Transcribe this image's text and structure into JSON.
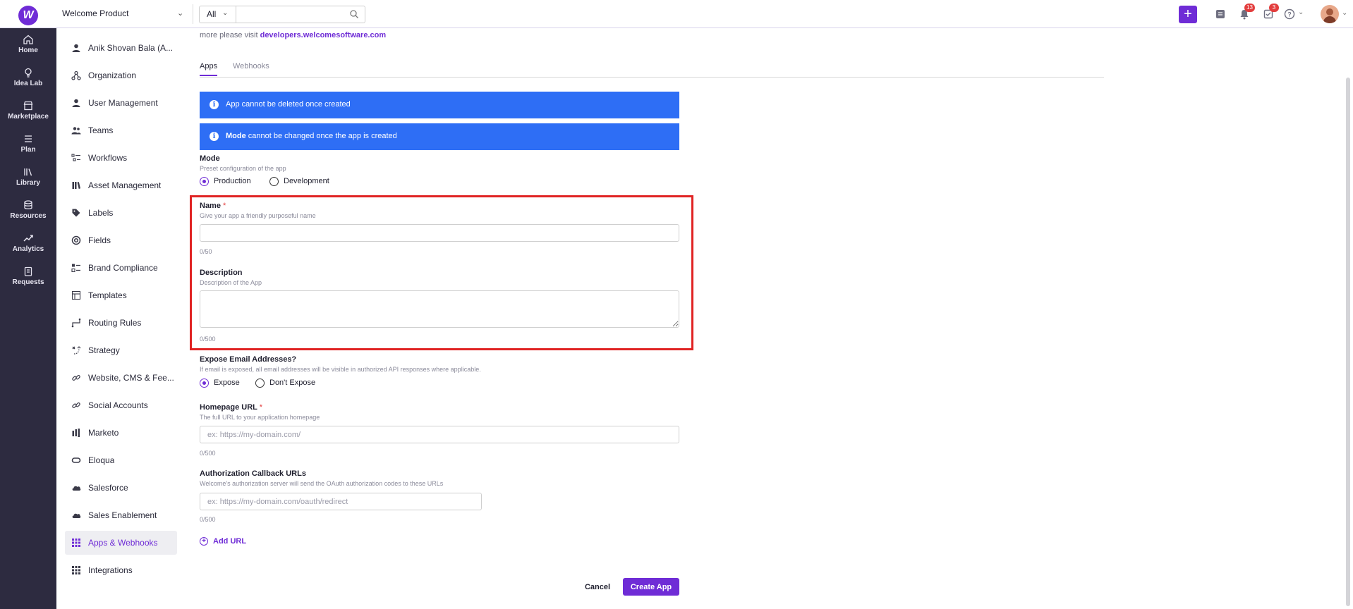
{
  "header": {
    "workspace": "Welcome Product",
    "search_scope": "All",
    "search_placeholder": "",
    "notifications_count": "13",
    "tasks_count": "3"
  },
  "rail": [
    {
      "label": "Home",
      "icon": "home-icon"
    },
    {
      "label": "Idea Lab",
      "icon": "lightbulb-icon"
    },
    {
      "label": "Marketplace",
      "icon": "store-icon"
    },
    {
      "label": "Plan",
      "icon": "list-icon"
    },
    {
      "label": "Library",
      "icon": "library-icon"
    },
    {
      "label": "Resources",
      "icon": "database-icon"
    },
    {
      "label": "Analytics",
      "icon": "trend-icon"
    },
    {
      "label": "Requests",
      "icon": "clipboard-icon"
    }
  ],
  "sidebar": {
    "items": [
      {
        "label": "Anik Shovan Bala (A...",
        "icon": "person-icon"
      },
      {
        "label": "Organization",
        "icon": "org-icon"
      },
      {
        "label": "User Management",
        "icon": "person-icon"
      },
      {
        "label": "Teams",
        "icon": "team-icon"
      },
      {
        "label": "Workflows",
        "icon": "workflow-icon"
      },
      {
        "label": "Asset Management",
        "icon": "books-icon"
      },
      {
        "label": "Labels",
        "icon": "tag-icon"
      },
      {
        "label": "Fields",
        "icon": "target-icon"
      },
      {
        "label": "Brand Compliance",
        "icon": "checklist-icon"
      },
      {
        "label": "Templates",
        "icon": "template-icon"
      },
      {
        "label": "Routing Rules",
        "icon": "routing-icon"
      },
      {
        "label": "Strategy",
        "icon": "strategy-icon"
      },
      {
        "label": "Website, CMS & Fee...",
        "icon": "link-icon"
      },
      {
        "label": "Social Accounts",
        "icon": "link-icon"
      },
      {
        "label": "Marketo",
        "icon": "marketo-icon"
      },
      {
        "label": "Eloqua",
        "icon": "eloqua-icon"
      },
      {
        "label": "Salesforce",
        "icon": "cloud-icon"
      },
      {
        "label": "Sales Enablement",
        "icon": "cloud-icon"
      },
      {
        "label": "Apps & Webhooks",
        "icon": "grid-icon"
      },
      {
        "label": "Integrations",
        "icon": "grid-icon"
      }
    ],
    "active_index": 18
  },
  "main": {
    "intro_text": "more please visit ",
    "intro_link": "developers.welcomesoftware.com",
    "tabs": [
      {
        "label": "Apps"
      },
      {
        "label": "Webhooks"
      }
    ],
    "alerts": [
      {
        "bold": "",
        "text": "App cannot be deleted once created"
      },
      {
        "bold": "Mode",
        "text": " cannot be changed once the app is created"
      }
    ],
    "mode": {
      "label": "Mode",
      "help": "Preset configuration of the app",
      "options": [
        "Production",
        "Development"
      ],
      "selected": "Production"
    },
    "name": {
      "label": "Name",
      "required_mark": "*",
      "help": "Give your app a friendly purposeful name",
      "value": "",
      "count": "0/50"
    },
    "description": {
      "label": "Description",
      "help": "Description of the App",
      "value": "",
      "count": "0/500"
    },
    "expose_email": {
      "label": "Expose Email Addresses?",
      "help": "If email is exposed, all email addresses will be visible in authorized API responses where applicable.",
      "options": [
        "Expose",
        "Don't Expose"
      ],
      "selected": "Expose"
    },
    "homepage_url": {
      "label": "Homepage URL",
      "required_mark": "*",
      "help": "The full URL to your application homepage",
      "placeholder": "ex: https://my-domain.com/",
      "count": "0/500"
    },
    "callback_urls": {
      "label": "Authorization Callback URLs",
      "help": "Welcome's authorization server will send the OAuth authorization codes to these URLs",
      "placeholder": "ex: https://my-domain.com/oauth/redirect",
      "count": "0/500"
    },
    "add_url_label": "Add URL",
    "cancel_label": "Cancel",
    "create_label": "Create App"
  },
  "colors": {
    "accent": "#6f2cd6",
    "alert_blue": "#2e6ef5",
    "rail_bg": "#2d2b40",
    "highlight_red": "#e02323",
    "badge_red": "#e33d3d"
  }
}
